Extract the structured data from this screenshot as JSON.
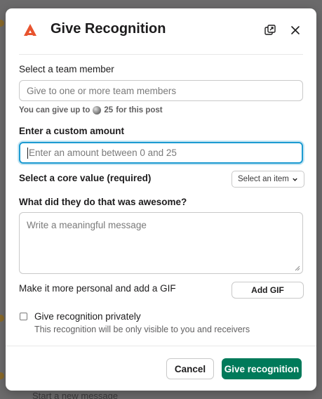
{
  "background": {
    "message_placeholder": "Start a new message"
  },
  "modal": {
    "title": "Give Recognition",
    "logo_icon": "app-logo-icon",
    "popout_icon": "popout-icon",
    "close_icon": "close-icon",
    "accent_color": "#e8542f"
  },
  "team_member": {
    "label": "Select a team member",
    "placeholder": "Give to one or more team members",
    "hint_prefix": "You can give up to",
    "hint_amount": "25",
    "hint_suffix": "for this post"
  },
  "amount": {
    "label": "Enter a custom amount",
    "placeholder": "Enter an amount between 0 and 25"
  },
  "core_value": {
    "label": "Select a core value (required)",
    "select_placeholder": "Select an item"
  },
  "message": {
    "label": "What did they do that was awesome?",
    "placeholder": "Write a meaningful message"
  },
  "gif": {
    "label": "Make it more personal and add a GIF",
    "button": "Add GIF"
  },
  "privacy": {
    "checkbox_label": "Give recognition privately",
    "description": "This recognition will be only visible to you and receivers",
    "checked": false
  },
  "footer": {
    "cancel": "Cancel",
    "submit": "Give recognition",
    "submit_color": "#007a5a"
  }
}
